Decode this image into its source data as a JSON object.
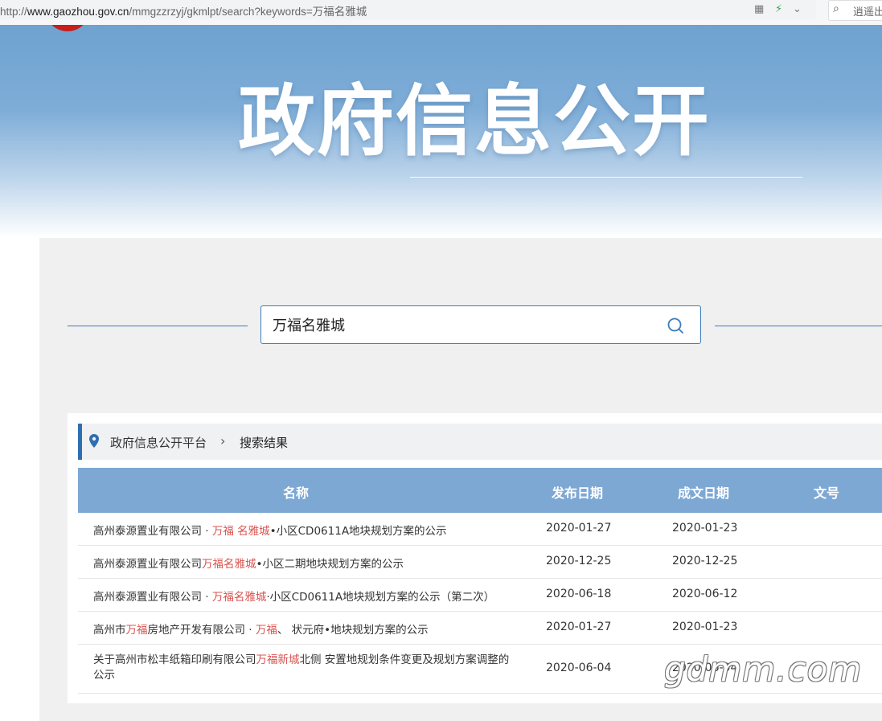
{
  "browser": {
    "url_prefix": "http://",
    "url_host": "www.gaozhou.gov.cn",
    "url_path": "/mmgzzrzyj/gkmlpt/search?keywords=万福名雅城",
    "grid_icon": "qr-grid-icon",
    "bolt_icon": "bolt-icon",
    "chevron_icon": "chevron-down-icon",
    "side_search_text": "逍遥出"
  },
  "banner": {
    "title": "政府信息公开"
  },
  "search": {
    "value": "万福名雅城"
  },
  "breadcrumb": {
    "home": "政府信息公开平台",
    "separator": "›",
    "current": "搜索结果"
  },
  "table": {
    "headers": {
      "name": "名称",
      "publish_date": "发布日期",
      "made_date": "成文日期",
      "doc_no": "文号"
    },
    "rows": [
      {
        "name_parts": [
          "高州泰源置业有限公司",
          " · ",
          "万福 名雅城",
          "•小区CD0611A地块规划方案的公示"
        ],
        "publish_date": "2020-01-27",
        "made_date": "2020-01-23"
      },
      {
        "name_parts": [
          "高州泰源置业有限公司",
          "",
          "万福名雅城",
          "•小区二期地块规划方案的公示"
        ],
        "publish_date": "2020-12-25",
        "made_date": "2020-12-25"
      },
      {
        "name_parts": [
          "高州泰源置业有限公司",
          " · ",
          "万福名雅城",
          "·小区CD0611A地块规划方案的公示（第二次）"
        ],
        "publish_date": "2020-06-18",
        "made_date": "2020-06-12"
      },
      {
        "name_parts": [
          "高州市",
          "万福",
          "房地产开发有限公司",
          " · ",
          "万福",
          "、 状元府•地块规划方案的公示"
        ],
        "publish_date": "2020-01-27",
        "made_date": "2020-01-23"
      },
      {
        "name_parts": [
          "关于高州市松丰纸箱印刷有限公司",
          "万福新城",
          "北侧 安置地规划条件变更及规划方案调整的公示"
        ],
        "publish_date": "2020-06-04",
        "made_date": "2020-06-04"
      }
    ]
  },
  "watermark": "gdmm.com",
  "colors": {
    "accent": "#3d7cb8",
    "header_bg": "#7da8d4",
    "highlight": "#d9534f"
  }
}
